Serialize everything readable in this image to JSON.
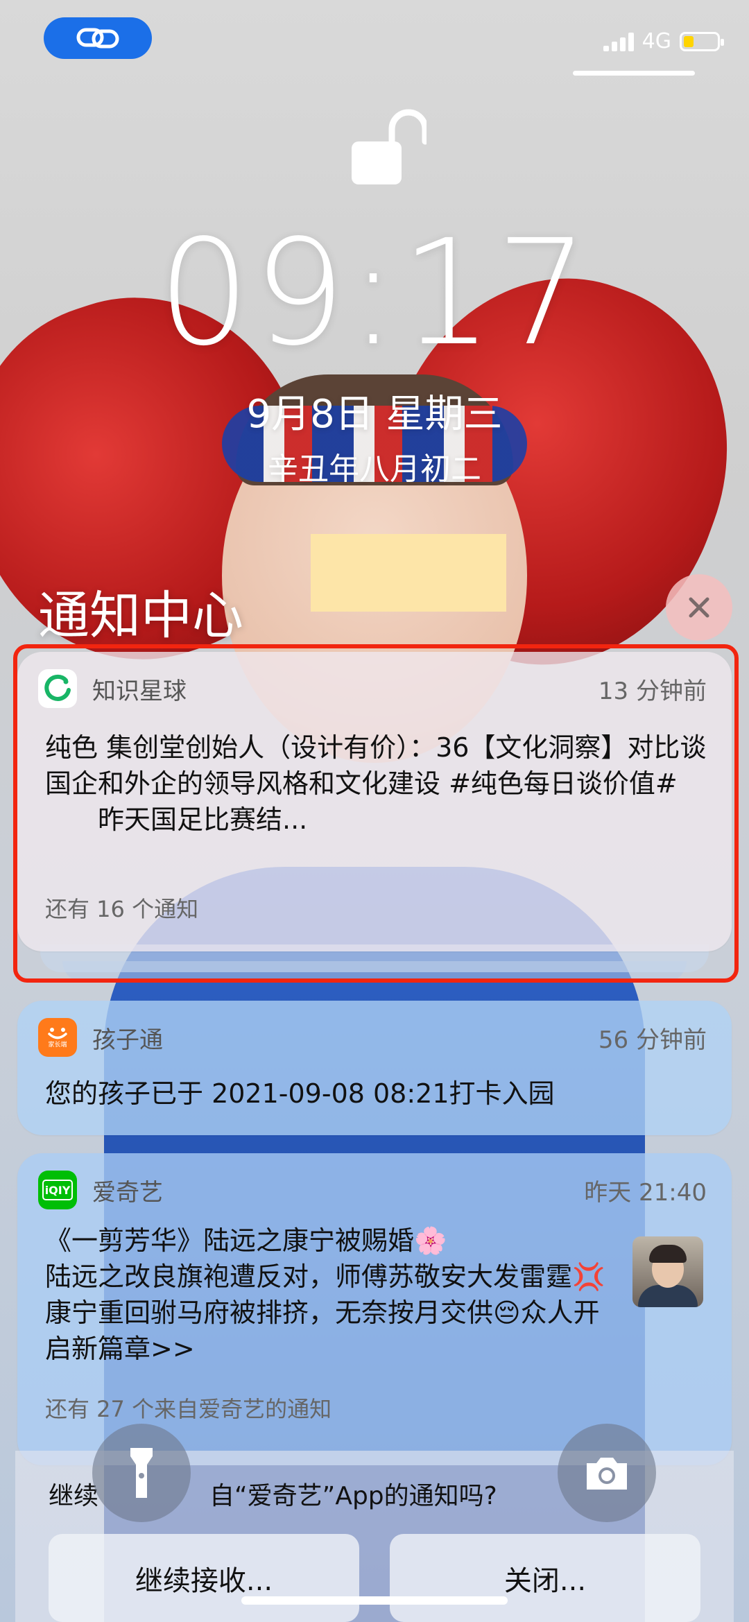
{
  "status_bar": {
    "network": "4G"
  },
  "lock_screen": {
    "time": "09:17",
    "date": "9月8日 星期三",
    "lunar_date": "辛丑年八月初二"
  },
  "notification_center": {
    "title": "通知中心",
    "notifications": [
      {
        "app": "知识星球",
        "time": "13 分钟前",
        "body": "纯色 集创堂创始人（设计有价）：36【文化洞察】对比谈国企和外企的领导风格和文化建设 #纯色每日谈价值#\n　　昨天国足比赛结...",
        "more": "还有 16 个通知"
      },
      {
        "app": "孩子通",
        "time": "56 分钟前",
        "body": "您的孩子已于 2021-09-08 08:21打卡入园",
        "icon_caption": "家长端"
      },
      {
        "app": "爱奇艺",
        "time": "昨天 21:40",
        "title": "《一剪芳华》陆远之康宁被赐婚🌸",
        "body": "陆远之改良旗袍遭反对，师傅苏敬安大发雷霆💢康宁重回驸马府被排挤，无奈按月交供😔众人开启新篇章>>",
        "more": "还有 27 个来自爱奇艺的通知"
      }
    ]
  },
  "prompt": {
    "text": "继续接收来自“爱奇艺”App的通知吗?",
    "text_visible_start": "继续",
    "text_visible_end": "自“爱奇艺”App的通知吗?",
    "continue_label": "继续接收...",
    "close_label": "关闭..."
  },
  "colors": {
    "highlight_border": "#f2250f",
    "status_pill": "#1b6fe8",
    "iqiyi_green": "#00be06",
    "haizitong_orange": "#ff7a1a"
  }
}
